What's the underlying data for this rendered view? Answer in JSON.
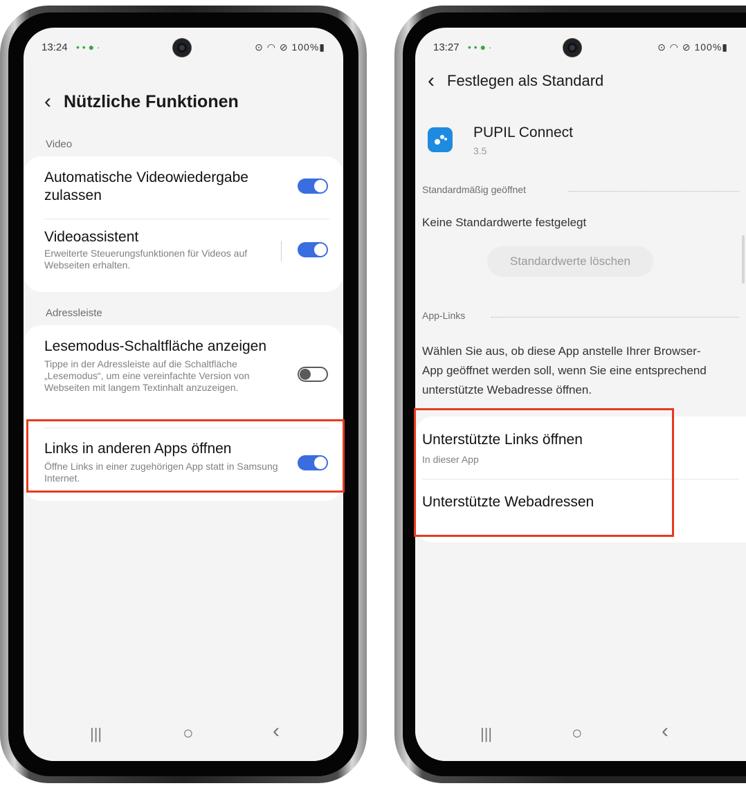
{
  "left": {
    "status": {
      "time": "13:24",
      "notif": "• • ● ·",
      "right": "⊙ ◠ ⊘ 100%▮"
    },
    "header": {
      "title": "Nützliche Funktionen"
    },
    "sections": [
      {
        "label": "Video"
      },
      {
        "label": "Adressleiste"
      }
    ],
    "items": [
      {
        "title": "Automatische Videowiedergabe zulassen",
        "subtitle": "",
        "toggle": true
      },
      {
        "title": "Videoassistent",
        "subtitle": "Erweiterte Steuerungsfunktionen für Videos auf Webseiten erhalten.",
        "toggle": true
      },
      {
        "title": "Lesemodus-Schaltfläche anzeigen",
        "subtitle": "Tippe in der Adressleiste auf die Schaltfläche „Lesemodus“, um eine vereinfachte Version von Webseiten mit langem Textinhalt anzuzeigen.",
        "toggle": false
      },
      {
        "title": "Links in anderen Apps öffnen",
        "subtitle": "Öffne Links in einer zugehörigen App statt in Samsung Internet.",
        "toggle": true
      }
    ]
  },
  "right": {
    "status": {
      "time": "13:27",
      "notif": "• • ● ·",
      "right": "⊙ ◠ ⊘ 100%▮"
    },
    "header": {
      "title": "Festlegen als Standard"
    },
    "app": {
      "name": "PUPIL Connect",
      "version": "3.5"
    },
    "sections": [
      {
        "label": "Standardmäßig geöffnet"
      },
      {
        "label": "App-Links"
      }
    ],
    "no_defaults": "Keine Standardwerte festgelegt",
    "clear_button": "Standardwerte löschen",
    "description": "Wählen Sie aus, ob diese App anstelle Ihrer Browser-App geöffnet werden soll, wenn Sie eine entsprechend unterstützte Webadresse öffnen.",
    "links": [
      {
        "title": "Unterstützte Links öffnen",
        "subtitle": "In dieser App"
      },
      {
        "title": "Unterstützte Webadressen",
        "subtitle": ""
      }
    ]
  },
  "nav": {
    "recents": "|||",
    "home": "○",
    "back": "‹"
  },
  "colors": {
    "accent": "#3a6ee0",
    "highlight": "#e8391e",
    "app_icon": "#1e8be0"
  }
}
